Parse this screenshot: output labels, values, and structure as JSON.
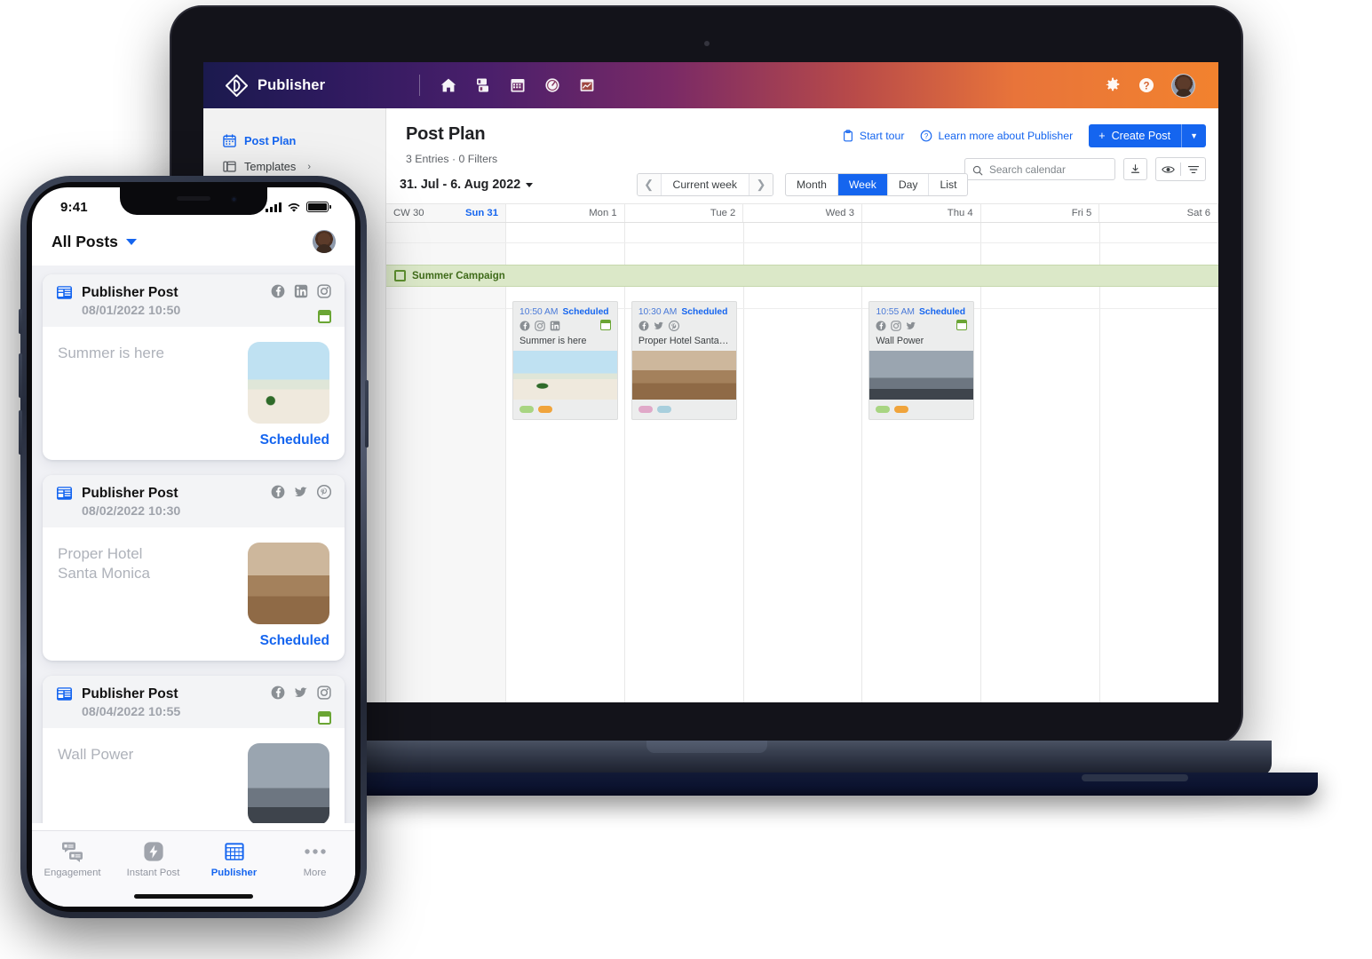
{
  "desktop": {
    "appbar": {
      "brand": "Publisher",
      "logo_icon": "publisher-diamond-logo",
      "nav_icons": [
        "home-icon",
        "engagement-icon",
        "calendar-icon",
        "dashboard-gauge-icon",
        "analytics-icon"
      ],
      "settings_icon": "gear-icon",
      "help_icon": "help-circle-icon",
      "avatar": "user-avatar"
    },
    "sidebar": {
      "items": [
        {
          "label": "Post Plan",
          "icon": "calendar-icon",
          "active": true,
          "chevron": ""
        },
        {
          "label": "Templates",
          "icon": "templates-icon",
          "active": false,
          "chevron": "›"
        }
      ]
    },
    "header": {
      "title": "Post Plan",
      "subtitle": "3 Entries  ·  0 Filters",
      "entries_text": "3 Entries",
      "filters_text": "0 Filters",
      "start_tour": "Start tour",
      "start_tour_icon": "clipboard-icon",
      "learn_more": "Learn more about Publisher",
      "learn_more_icon": "question-circle-icon",
      "create_post": "Create Post",
      "create_post_plus": "+",
      "create_post_caret": "▼"
    },
    "toolbar": {
      "search_placeholder": "Search calendar",
      "search_value": "",
      "search_icon": "search-icon",
      "download_icon": "download-icon",
      "eye_icon": "eye-icon",
      "filter_icon": "filter-icon"
    },
    "calendar_toolbar": {
      "range_label": "31. Jul - 6. Aug 2022",
      "range_caret": "▼",
      "prev_icon": "chevron-left-icon",
      "next_icon": "chevron-right-icon",
      "current_week": "Current week",
      "views": [
        {
          "label": "Month",
          "active": false
        },
        {
          "label": "Week",
          "active": true
        },
        {
          "label": "Day",
          "active": false
        },
        {
          "label": "List",
          "active": false
        }
      ]
    },
    "calendar": {
      "week_number": "CW 30",
      "days": [
        {
          "label": "Sun 31",
          "weekend": true,
          "highlight": true
        },
        {
          "label": "Mon 1",
          "weekend": false,
          "highlight": false
        },
        {
          "label": "Tue 2",
          "weekend": false,
          "highlight": false
        },
        {
          "label": "Wed 3",
          "weekend": false,
          "highlight": false
        },
        {
          "label": "Thu 4",
          "weekend": false,
          "highlight": false
        },
        {
          "label": "Fri 5",
          "weekend": false,
          "highlight": false
        },
        {
          "label": "Sat 6",
          "weekend": false,
          "highlight": false
        }
      ],
      "campaign": {
        "label": "Summer Campaign",
        "color": "#dbe8c8",
        "text_color": "#3f6b1a"
      },
      "events": [
        {
          "day_index": 1,
          "time": "10:50 AM",
          "status": "Scheduled",
          "text": "Summer is here",
          "channels": [
            "facebook",
            "instagram",
            "linkedin"
          ],
          "has_campaign_badge": true,
          "tags": [
            "#a8d582",
            "#f0a43c"
          ],
          "thumb": "thumb-summer"
        },
        {
          "day_index": 2,
          "time": "10:30 AM",
          "status": "Scheduled",
          "text": "Proper Hotel Santa Mon…",
          "channels": [
            "facebook",
            "twitter",
            "pinterest"
          ],
          "has_campaign_badge": false,
          "tags": [
            "#e0a8c8",
            "#a8cfdd"
          ],
          "thumb": "thumb-hotel"
        },
        {
          "day_index": 4,
          "time": "10:55 AM",
          "status": "Scheduled",
          "text": "Wall Power",
          "channels": [
            "facebook",
            "instagram",
            "twitter"
          ],
          "has_campaign_badge": true,
          "tags": [
            "#a8d582",
            "#f0a43c"
          ],
          "thumb": "thumb-wall"
        }
      ]
    }
  },
  "phone": {
    "status_bar": {
      "time": "9:41",
      "signal_icon": "cellular-bars-icon",
      "wifi_icon": "wifi-icon",
      "battery_icon": "battery-icon"
    },
    "nav": {
      "title": "All Posts",
      "caret": "chevron-down-icon",
      "avatar": "user-avatar"
    },
    "posts": [
      {
        "title": "Publisher Post",
        "icon": "publisher-post-icon",
        "datetime": "08/01/2022 10:50",
        "text": "Summer is here",
        "channels": [
          "facebook",
          "linkedin",
          "instagram"
        ],
        "has_campaign_badge": true,
        "status": "Scheduled",
        "thumb": "thumb-summer"
      },
      {
        "title": "Publisher Post",
        "icon": "publisher-post-icon",
        "datetime": "08/02/2022 10:30",
        "text": "Proper Hotel\nSanta Monica",
        "channels": [
          "facebook",
          "twitter",
          "pinterest"
        ],
        "has_campaign_badge": false,
        "status": "Scheduled",
        "thumb": "thumb-hotel"
      },
      {
        "title": "Publisher Post",
        "icon": "publisher-post-icon",
        "datetime": "08/04/2022 10:55",
        "text": "Wall Power",
        "channels": [
          "facebook",
          "twitter",
          "instagram"
        ],
        "has_campaign_badge": true,
        "status": "",
        "thumb": "thumb-wall"
      }
    ],
    "tabs": [
      {
        "label": "Engagement",
        "icon": "engagement-icon",
        "active": false
      },
      {
        "label": "Instant Post",
        "icon": "lightning-icon",
        "active": false
      },
      {
        "label": "Publisher",
        "icon": "calendar-grid-icon",
        "active": true
      },
      {
        "label": "More",
        "icon": "ellipsis-icon",
        "active": false
      }
    ]
  },
  "colors": {
    "accent": "#1565ef",
    "campaign_green": "#6aa534",
    "campaign_band": "#dbe8c8"
  }
}
